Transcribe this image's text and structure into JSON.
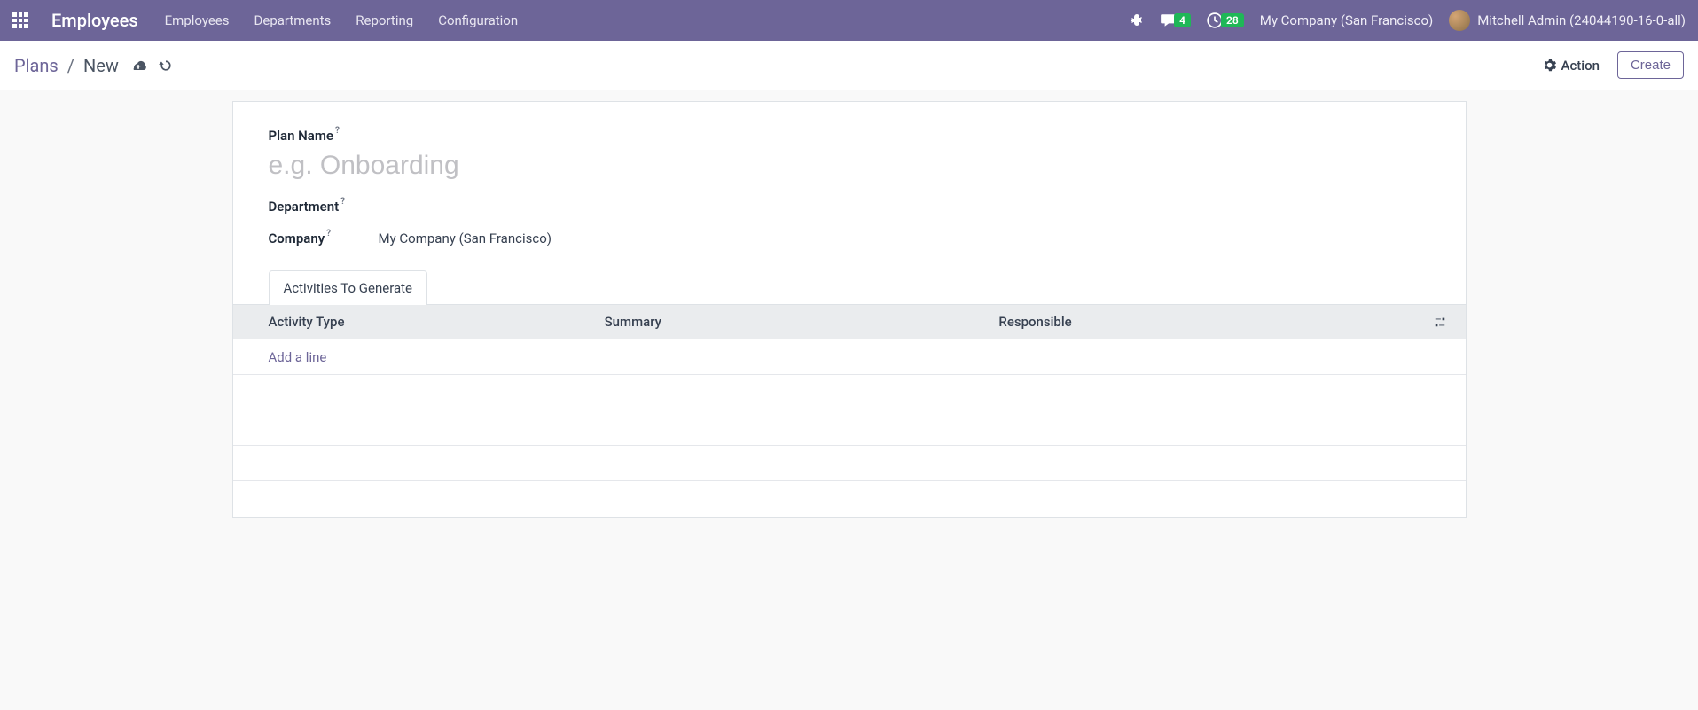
{
  "navbar": {
    "brand": "Employees",
    "items": [
      "Employees",
      "Departments",
      "Reporting",
      "Configuration"
    ],
    "messages_count": "4",
    "activities_count": "28",
    "company": "My Company (San Francisco)",
    "user": "Mitchell Admin (24044190-16-0-all)"
  },
  "breadcrumb": {
    "parent": "Plans",
    "separator": "/",
    "current": "New"
  },
  "control": {
    "action_label": "Action",
    "create_label": "Create"
  },
  "form": {
    "plan_name_label": "Plan Name",
    "plan_name_placeholder": "e.g. Onboarding",
    "plan_name_value": "",
    "department_label": "Department",
    "department_value": "",
    "company_label": "Company",
    "company_value": "My Company (San Francisco)",
    "help_glyph": "?"
  },
  "notebook": {
    "tab_label": "Activities To Generate",
    "columns": {
      "activity_type": "Activity Type",
      "summary": "Summary",
      "responsible": "Responsible"
    },
    "add_line": "Add a line"
  }
}
